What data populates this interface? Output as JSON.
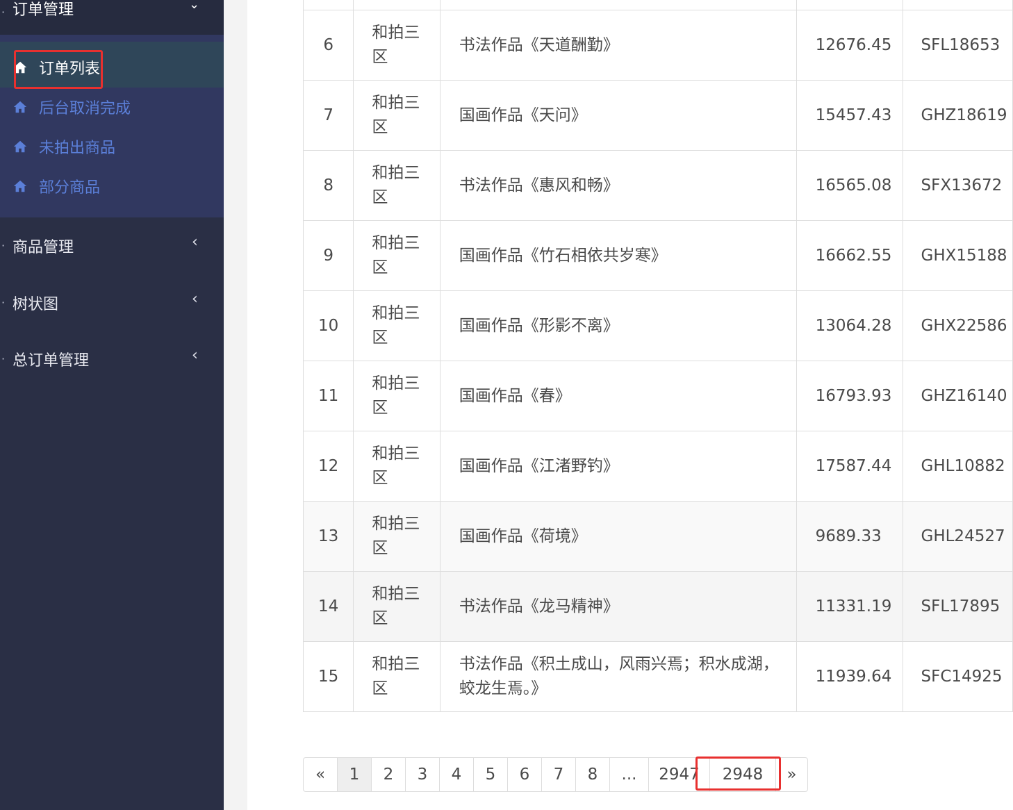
{
  "sidebar": {
    "open_menu": {
      "label": "订单管理"
    },
    "submenu": [
      {
        "label": "订单列表",
        "active": true
      },
      {
        "label": "后台取消完成",
        "active": false
      },
      {
        "label": "未拍出商品",
        "active": false
      },
      {
        "label": "部分商品",
        "active": false
      }
    ],
    "menus": [
      {
        "label": "商品管理"
      },
      {
        "label": "树状图"
      },
      {
        "label": "总订单管理"
      }
    ]
  },
  "table": {
    "rows": [
      {
        "num": "6",
        "area": "和拍三区",
        "name": "书法作品《天道酬勤》",
        "price": "12676.45",
        "code": "SFL18653"
      },
      {
        "num": "7",
        "area": "和拍三区",
        "name": "国画作品《天问》",
        "price": "15457.43",
        "code": "GHZ18619"
      },
      {
        "num": "8",
        "area": "和拍三区",
        "name": "书法作品《惠风和畅》",
        "price": "16565.08",
        "code": "SFX13672"
      },
      {
        "num": "9",
        "area": "和拍三区",
        "name": "国画作品《竹石相依共岁寒》",
        "price": "16662.55",
        "code": "GHX15188"
      },
      {
        "num": "10",
        "area": "和拍三区",
        "name": "国画作品《形影不离》",
        "price": "13064.28",
        "code": "GHX22586"
      },
      {
        "num": "11",
        "area": "和拍三区",
        "name": "国画作品《春》",
        "price": "16793.93",
        "code": "GHZ16140"
      },
      {
        "num": "12",
        "area": "和拍三区",
        "name": "国画作品《江渚野钓》",
        "price": "17587.44",
        "code": "GHL10882"
      },
      {
        "num": "13",
        "area": "和拍三区",
        "name": "国画作品《荷境》",
        "price": "9689.33",
        "code": "GHL24527"
      },
      {
        "num": "14",
        "area": "和拍三区",
        "name": "书法作品《龙马精神》",
        "price": "11331.19",
        "code": "SFL17895"
      },
      {
        "num": "15",
        "area": "和拍三区",
        "name": "书法作品《积土成山，风雨兴焉；积水成湖，蛟龙生焉。》",
        "price": "11939.64",
        "code": "SFC14925"
      }
    ]
  },
  "pagination": {
    "prev": "«",
    "pages": [
      "1",
      "2",
      "3",
      "4",
      "5",
      "6",
      "7",
      "8",
      "...",
      "2947",
      "2948"
    ],
    "next": "»",
    "current": "1"
  },
  "colors": {
    "sidebar_bg": "#2a2f45",
    "submenu_bg": "#313860",
    "submenu_link": "#5b7fd8",
    "highlight_box": "#e8302f"
  },
  "icons": {
    "submenu_item": "home-icon",
    "menu_open": "chevron-down-icon",
    "menu_closed": "chevron-left-icon"
  }
}
